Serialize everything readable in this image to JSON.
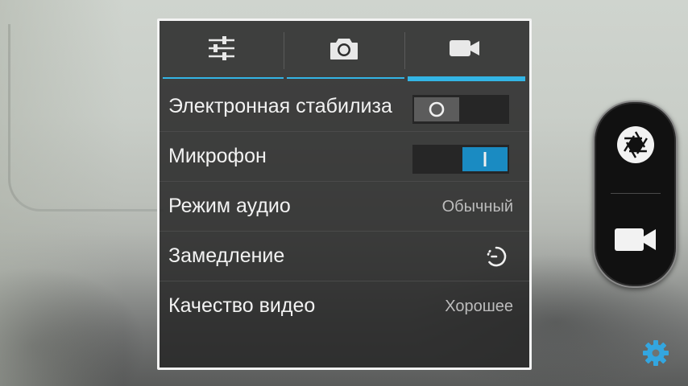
{
  "viewfinder": {
    "description_visible": false
  },
  "tabs": [
    {
      "icon": "sliders-icon",
      "active": false
    },
    {
      "icon": "camera-icon",
      "active": false
    },
    {
      "icon": "video-camera-icon",
      "active": true
    }
  ],
  "settings": {
    "stabilization": {
      "label": "Электронная стабилиза",
      "state": "off"
    },
    "microphone": {
      "label": "Микрофон",
      "state": "on"
    },
    "audio_mode": {
      "label": "Режим аудио",
      "value": "Обычный"
    },
    "slow_motion": {
      "label": "Замедление",
      "icon": "timer-icon"
    },
    "video_quality": {
      "label": "Качество видео",
      "value": "Хорошее"
    }
  },
  "shutter": {
    "photo_icon": "aperture-icon",
    "video_icon": "video-camera-icon"
  },
  "settings_button": {
    "icon": "gear-icon"
  },
  "colors": {
    "accent": "#33b5e5",
    "switch_on": "#1a8bc2",
    "gear": "#33a6e0"
  }
}
